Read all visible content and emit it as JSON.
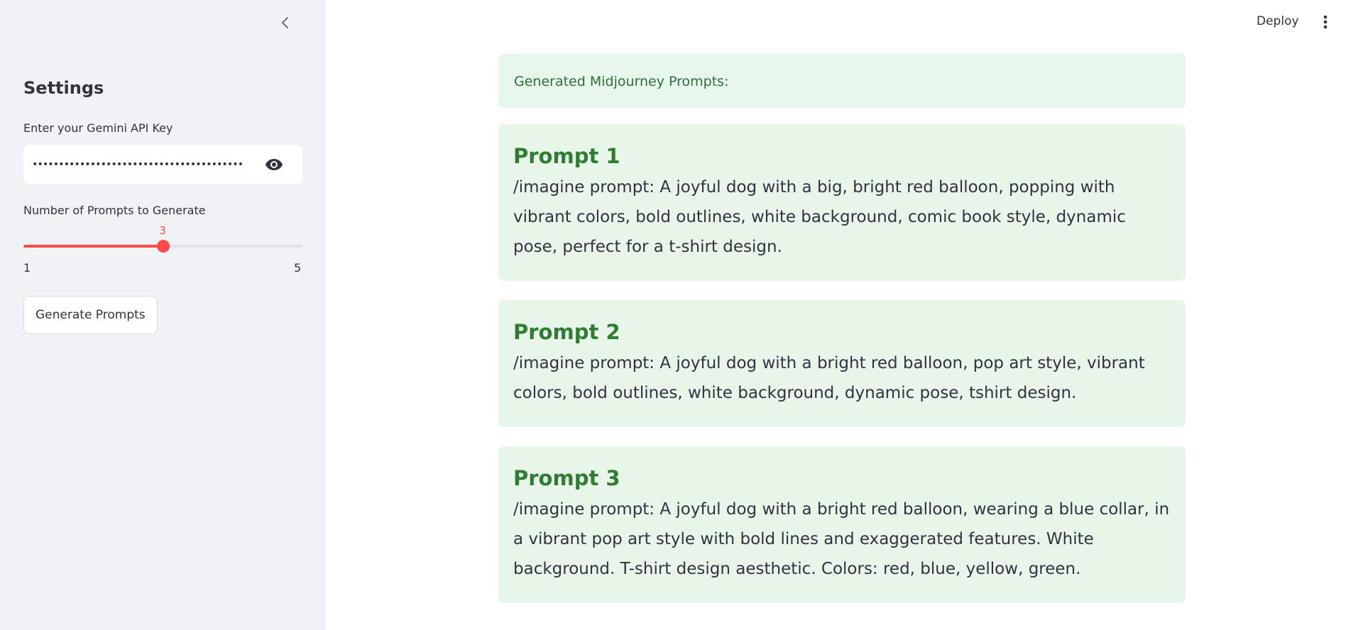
{
  "sidebar": {
    "title": "Settings",
    "api_key": {
      "label": "Enter your Gemini API Key",
      "value": "••••••••••••••••••••••••••••••••••••••••"
    },
    "slider": {
      "label": "Number of Prompts to Generate",
      "value": "3",
      "min": "1",
      "max": "5",
      "fraction": 0.5
    },
    "button_label": "Generate Prompts"
  },
  "header": {
    "deploy_label": "Deploy"
  },
  "main": {
    "success_message": "Generated Midjourney Prompts:",
    "prompts": [
      {
        "title": "Prompt 1",
        "text": "/imagine prompt: A joyful dog with a big, bright red balloon, popping with vibrant colors, bold outlines, white background, comic book style, dynamic pose, perfect for a t-shirt design."
      },
      {
        "title": "Prompt 2",
        "text": "/imagine prompt: A joyful dog with a bright red balloon, pop art style, vibrant colors, bold outlines, white background, dynamic pose, tshirt design."
      },
      {
        "title": "Prompt 3",
        "text": "/imagine prompt: A joyful dog with a bright red balloon, wearing a blue collar, in a vibrant pop art style with bold lines and exaggerated features. White background. T-shirt design aesthetic. Colors: red, blue, yellow, green."
      }
    ]
  },
  "colors": {
    "accent": "#ff4b4b",
    "prompt_title": "#2e7d32",
    "card_bg": "#e8f5e9",
    "sidebar_bg": "#f0f2f6"
  },
  "icons": {
    "collapse": "chevron-left-icon",
    "password_toggle": "eye-icon",
    "menu": "more-vertical-icon"
  }
}
